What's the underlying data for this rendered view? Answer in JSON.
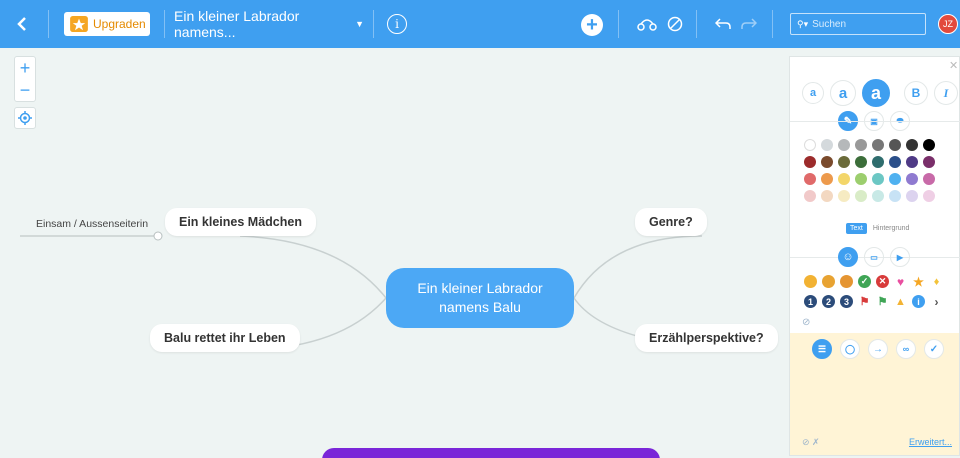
{
  "toolbar": {
    "back_icon": "chevron-left-icon",
    "upgrade_label": "Upgraden",
    "map_title": "Ein kleiner Labrador namens...",
    "info_label": "i",
    "search_placeholder": "Suchen",
    "user_initials": "JZ"
  },
  "map": {
    "central": {
      "line1": "Ein kleiner Labrador",
      "line2": "namens Balu"
    },
    "nodes": [
      {
        "label": "Ein kleines Mädchen"
      },
      {
        "label": "Balu rettet ihr Leben"
      },
      {
        "label": "Genre?"
      },
      {
        "label": "Erzählperspektive?"
      }
    ],
    "leaf": {
      "label": "Einsam / Aussenseiterin"
    }
  },
  "panel": {
    "font_sizes": [
      "a",
      "a",
      "a"
    ],
    "bold_label": "B",
    "italic_label": "I",
    "color_tab_text": "Text",
    "color_tab_background": "Hintergrund",
    "advanced_link": "Erweitert...",
    "colors": [
      [
        "#ffffff",
        "#d4d9dc",
        "#b5b8ba",
        "#999999",
        "#777777",
        "#555555",
        "#333333",
        "#000000"
      ],
      [
        "#9c2b2b",
        "#7a4a2c",
        "#6b6b3a",
        "#3c6e3a",
        "#2f6d6e",
        "#2b4f8a",
        "#4f3a86",
        "#7a2f6a"
      ],
      [
        "#e06a6a",
        "#ed9a4c",
        "#f3d66a",
        "#9cce6e",
        "#6cc7c4",
        "#4fb1f0",
        "#8f7ad0",
        "#c86aa8"
      ],
      [
        "#f1c9c9",
        "#f3d8c1",
        "#f6ebc2",
        "#d9ecc7",
        "#c8e9e6",
        "#c7e2f5",
        "#dcd3ef",
        "#efcfe5"
      ]
    ],
    "accent": "#3f9ff0"
  }
}
